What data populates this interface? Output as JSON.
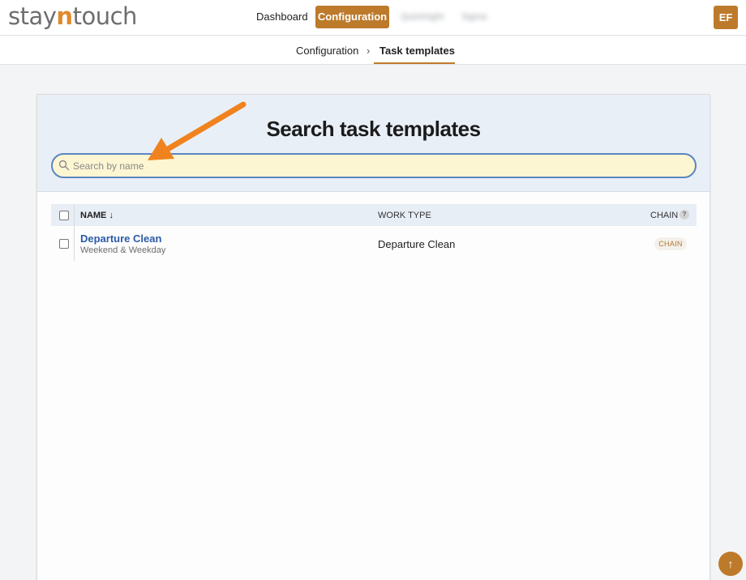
{
  "brand": {
    "logo_prefix": "stay",
    "logo_accent": "n",
    "logo_suffix": "touch"
  },
  "nav": {
    "items": [
      {
        "label": "Dashboard"
      },
      {
        "label": "Configuration",
        "active": true
      },
      {
        "label": "QuickSight"
      },
      {
        "label": "Sigma"
      }
    ]
  },
  "user": {
    "initials": "EF"
  },
  "breadcrumb": {
    "parent": "Configuration",
    "separator": "›",
    "current": "Task templates"
  },
  "page": {
    "title": "Search task templates",
    "search_placeholder": "Search by name"
  },
  "table": {
    "columns": {
      "name": "NAME ↓",
      "work_type": "WORK TYPE",
      "chain": "CHAIN",
      "chain_help": "?"
    },
    "rows": [
      {
        "name": "Departure Clean",
        "schedule": "Weekend & Weekday",
        "work_type": "Departure Clean",
        "chain_badge": "CHAIN"
      }
    ]
  },
  "scroll_top": {
    "symbol": "↑"
  },
  "colors": {
    "accent": "#bd7a2b",
    "link": "#2b5aa8",
    "search_bg": "#fdf6d2",
    "search_border": "#5a86c0",
    "annotation_arrow": "#f0831f"
  }
}
